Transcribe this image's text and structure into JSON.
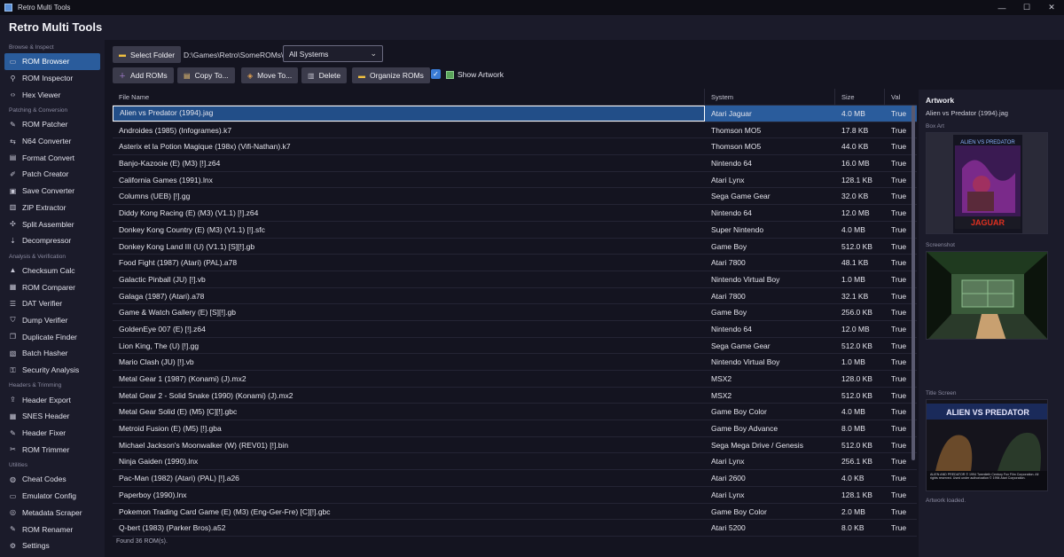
{
  "window": {
    "title": "Retro Multi Tools",
    "minimize": "—",
    "maximize": "☐",
    "close": "✕"
  },
  "app": {
    "title": "Retro Multi Tools"
  },
  "sidebar": {
    "sections": [
      {
        "label": "Browse & Inspect",
        "items": [
          {
            "label": "ROM Browser",
            "icon": "folder-icon",
            "glyph": "▭",
            "active": true
          },
          {
            "label": "ROM Inspector",
            "icon": "magnifier-icon",
            "glyph": "⚲"
          },
          {
            "label": "Hex Viewer",
            "icon": "code-icon",
            "glyph": "‹›"
          }
        ]
      },
      {
        "label": "Patching & Conversion",
        "items": [
          {
            "label": "ROM Patcher",
            "icon": "wrench-icon",
            "glyph": "✎"
          },
          {
            "label": "N64 Converter",
            "icon": "swap-icon",
            "glyph": "⇆"
          },
          {
            "label": "Format Convert",
            "icon": "document-icon",
            "glyph": "▤"
          },
          {
            "label": "Patch Creator",
            "icon": "pencil-icon",
            "glyph": "✐"
          },
          {
            "label": "Save Converter",
            "icon": "save-icon",
            "glyph": "▣"
          },
          {
            "label": "ZIP Extractor",
            "icon": "archive-icon",
            "glyph": "▥"
          },
          {
            "label": "Split Assembler",
            "icon": "puzzle-icon",
            "glyph": "✣"
          },
          {
            "label": "Decompressor",
            "icon": "download-icon",
            "glyph": "⇣"
          }
        ]
      },
      {
        "label": "Analysis & Verification",
        "items": [
          {
            "label": "Checksum Calc",
            "icon": "triangle-icon",
            "glyph": "▲"
          },
          {
            "label": "ROM Comparer",
            "icon": "compare-icon",
            "glyph": "▦"
          },
          {
            "label": "DAT Verifier",
            "icon": "list-icon",
            "glyph": "☰"
          },
          {
            "label": "Dump Verifier",
            "icon": "shield-icon",
            "glyph": "⛉"
          },
          {
            "label": "Duplicate Finder",
            "icon": "copy-icon",
            "glyph": "❐"
          },
          {
            "label": "Batch Hasher",
            "icon": "batch-icon",
            "glyph": "▧"
          },
          {
            "label": "Security Analysis",
            "icon": "lock-icon",
            "glyph": "⚿"
          }
        ]
      },
      {
        "label": "Headers & Trimming",
        "items": [
          {
            "label": "Header Export",
            "icon": "export-icon",
            "glyph": "⇪"
          },
          {
            "label": "SNES Header",
            "icon": "grid-icon",
            "glyph": "▦"
          },
          {
            "label": "Header Fixer",
            "icon": "wrench-icon",
            "glyph": "✎"
          },
          {
            "label": "ROM Trimmer",
            "icon": "scissors-icon",
            "glyph": "✂"
          }
        ]
      },
      {
        "label": "Utilities",
        "items": [
          {
            "label": "Cheat Codes",
            "icon": "gamepad-icon",
            "glyph": "◍"
          },
          {
            "label": "Emulator Config",
            "icon": "monitor-icon",
            "glyph": "▭"
          },
          {
            "label": "Metadata Scraper",
            "icon": "globe-icon",
            "glyph": "◎"
          },
          {
            "label": "ROM Renamer",
            "icon": "rename-icon",
            "glyph": "✎"
          },
          {
            "label": "Settings",
            "icon": "gear-icon",
            "glyph": "⚙"
          }
        ]
      }
    ]
  },
  "toolbar": {
    "select_folder": "Select Folder",
    "path": "D:\\Games\\Retro\\SomeROMs\\",
    "system_filter": "All Systems",
    "add_roms": "Add ROMs",
    "copy_to": "Copy To...",
    "move_to": "Move To...",
    "delete": "Delete",
    "organize": "Organize ROMs",
    "show_artwork": "Show Artwork",
    "show_artwork_checked": true
  },
  "table": {
    "headers": [
      "File Name",
      "System",
      "Size",
      "Val"
    ],
    "rows": [
      [
        "Alien vs Predator (1994).jag",
        "Atari Jaguar",
        "4.0 MB",
        "True"
      ],
      [
        "Androides (1985) (Infogrames).k7",
        "Thomson MO5",
        "17.8 KB",
        "True"
      ],
      [
        "Asterix et la Potion Magique (198x) (Vifi-Nathan).k7",
        "Thomson MO5",
        "44.0 KB",
        "True"
      ],
      [
        "Banjo-Kazooie (E) (M3) [!].z64",
        "Nintendo 64",
        "16.0 MB",
        "True"
      ],
      [
        "California Games (1991).lnx",
        "Atari Lynx",
        "128.1 KB",
        "True"
      ],
      [
        "Columns (UEB) [!].gg",
        "Sega Game Gear",
        "32.0 KB",
        "True"
      ],
      [
        "Diddy Kong Racing (E) (M3) (V1.1) [!].z64",
        "Nintendo 64",
        "12.0 MB",
        "True"
      ],
      [
        "Donkey Kong Country (E) (M3) (V1.1) [!].sfc",
        "Super Nintendo",
        "4.0 MB",
        "True"
      ],
      [
        "Donkey Kong Land III (U) (V1.1) [S][!].gb",
        "Game Boy",
        "512.0 KB",
        "True"
      ],
      [
        "Food Fight (1987) (Atari) (PAL).a78",
        "Atari 7800",
        "48.1 KB",
        "True"
      ],
      [
        "Galactic Pinball (JU) [!].vb",
        "Nintendo Virtual Boy",
        "1.0 MB",
        "True"
      ],
      [
        "Galaga (1987) (Atari).a78",
        "Atari 7800",
        "32.1 KB",
        "True"
      ],
      [
        "Game & Watch Gallery (E) [S][!].gb",
        "Game Boy",
        "256.0 KB",
        "True"
      ],
      [
        "GoldenEye 007 (E) [!].z64",
        "Nintendo 64",
        "12.0 MB",
        "True"
      ],
      [
        "Lion King, The (U) [!].gg",
        "Sega Game Gear",
        "512.0 KB",
        "True"
      ],
      [
        "Mario Clash (JU) [!].vb",
        "Nintendo Virtual Boy",
        "1.0 MB",
        "True"
      ],
      [
        "Metal Gear 1 (1987) (Konami) (J).mx2",
        "MSX2",
        "128.0 KB",
        "True"
      ],
      [
        "Metal Gear 2 - Solid Snake (1990) (Konami) (J).mx2",
        "MSX2",
        "512.0 KB",
        "True"
      ],
      [
        "Metal Gear Solid (E) (M5) [C][!].gbc",
        "Game Boy Color",
        "4.0 MB",
        "True"
      ],
      [
        "Metroid Fusion (E) (M5) [!].gba",
        "Game Boy Advance",
        "8.0 MB",
        "True"
      ],
      [
        "Michael Jackson's Moonwalker (W) (REV01) [!].bin",
        "Sega Mega Drive / Genesis",
        "512.0 KB",
        "True"
      ],
      [
        "Ninja Gaiden (1990).lnx",
        "Atari Lynx",
        "256.1 KB",
        "True"
      ],
      [
        "Pac-Man (1982) (Atari) (PAL) [!].a26",
        "Atari 2600",
        "4.0 KB",
        "True"
      ],
      [
        "Paperboy (1990).lnx",
        "Atari Lynx",
        "128.1 KB",
        "True"
      ],
      [
        "Pokemon Trading Card Game (E) (M3) (Eng-Ger-Fre) [C][!].gbc",
        "Game Boy Color",
        "2.0 MB",
        "True"
      ],
      [
        "Q-bert (1983) (Parker Bros).a52",
        "Atari 5200",
        "8.0 KB",
        "True"
      ]
    ],
    "selected_row": 0
  },
  "status": "Found 36 ROM(s).",
  "artwork": {
    "title": "Artwork",
    "file": "Alien vs Predator (1994).jag",
    "box_art_label": "Box Art",
    "screenshot_label": "Screenshot",
    "title_screen_label": "Title Screen",
    "status": "Artwork loaded.",
    "box_logo_top": "ALIEN VS PREDATOR",
    "box_logo_bottom": "JAGUAR",
    "title_logo": "ALIEN VS PREDATOR",
    "title_caption": "ALIEN AND PREDATOR © 1994 Twentieth Century Fox Film Corporation. All rights reserved. Used under authorization © 1994 Atari Corporation."
  },
  "colors": {
    "accent": "#2a5c9c",
    "background": "#141420",
    "sidebar": "#1b1b2a"
  }
}
